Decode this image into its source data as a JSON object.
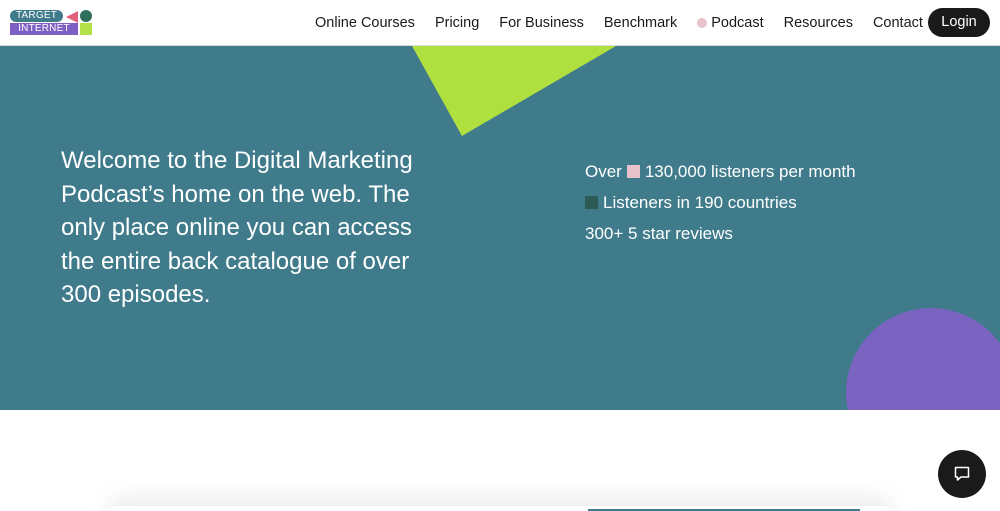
{
  "brand": {
    "logo_top": "TARGET",
    "logo_bottom": "INTERNET"
  },
  "nav": {
    "items": [
      {
        "label": "Online Courses"
      },
      {
        "label": "Pricing"
      },
      {
        "label": "For Business"
      },
      {
        "label": "Benchmark"
      },
      {
        "label": "Podcast",
        "has_dot": true
      },
      {
        "label": "Resources"
      },
      {
        "label": "Contact"
      }
    ],
    "login_label": "Login"
  },
  "hero": {
    "heading": "Welcome to the Digital Marketing Podcast’s home on the web. The only place online you can access the entire back catalogue of over 300 episodes.",
    "stats": {
      "listeners_prefix": "Over",
      "listeners": "130,000 listeners per month",
      "countries": "Listeners in 190 countries",
      "reviews": "300+ 5 star reviews"
    }
  },
  "icons": {
    "chat": "chat-bubble-icon"
  },
  "colors": {
    "hero_bg": "#3f7b8b",
    "triangle": "#b0e040",
    "circle": "#7b63c1",
    "pink_square": "#e8c3cc",
    "dark_square": "#2d5a54",
    "login_bg": "#1a1a1a"
  }
}
